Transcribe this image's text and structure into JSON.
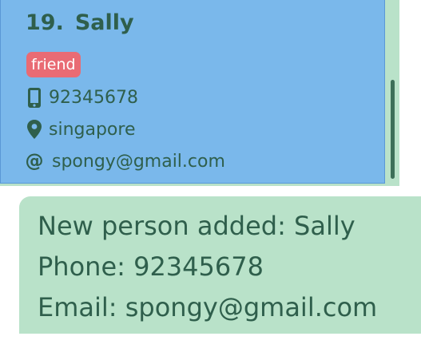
{
  "person_card": {
    "index": "19.",
    "name": "Sally",
    "tag": "friend",
    "phone": "92345678",
    "address": "singapore",
    "email": "spongy@gmail.com",
    "email_icon_glyph": "@",
    "icons": {
      "phone": "mobile-phone-icon",
      "address": "map-marker-icon",
      "email": "at-sign-icon"
    }
  },
  "result_display": {
    "lines": [
      "New person added: Sally",
      "Phone: 92345678",
      "Email: spongy@gmail.com"
    ]
  },
  "colors": {
    "card_background": "#7ab8eb",
    "panel_background": "#b9e2c9",
    "text": "#2f5f4c",
    "tag_background": "#e96b74",
    "tag_text": "#ffffff",
    "scrollbar_thumb": "#3d6f58"
  }
}
